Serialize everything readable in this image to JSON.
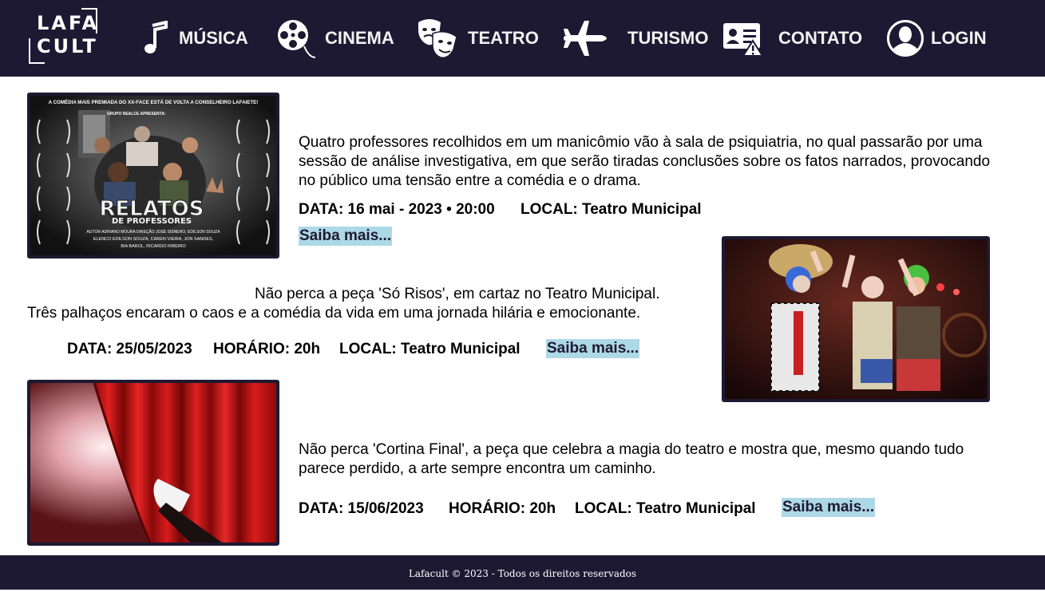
{
  "brand": {
    "line1": "LAFA",
    "line2": "CULT"
  },
  "nav": {
    "musica": "MÚSICA",
    "cinema": "CINEMA",
    "teatro": "TEATRO",
    "turismo": "TURISMO",
    "contato": "CONTATO",
    "login": "LOGIN"
  },
  "events": [
    {
      "poster_text": {
        "top": "A COMÉDIA MAIS PREMIADA DO XX-FACE ESTÁ DE VOLTA A CONSELHEIRO LAFAIETE!",
        "sub": "GRUPO REALCE APRESENTA:",
        "title": "RELATOS",
        "title2": "DE PROFESSORES",
        "credits1": "AUTOR  ADRIANO MOURA   DIREÇÃO  JOSÉ SISNERO, EDILSON SOUZA",
        "credits2": "ELENCO  EDILSON SOUZA, CAREN VIEIRA, JON SANDES,",
        "credits3": "BIA BAROL, RICARDO RIBEIRO"
      },
      "description": "Quatro professores recolhidos em um manicômio vão à sala de psiquiatria, no qual passarão por uma sessão de análise investigativa, em que serão tiradas conclusões sobre os fatos narrados, provocando no público uma tensão entre a comédia e o drama.",
      "date": "DATA: 16 mai - 2023 • 20:00",
      "local": "LOCAL: Teatro Municipal",
      "more": "Saiba mais..."
    },
    {
      "description_line1": "Não perca a peça 'Só Risos', em cartaz no Teatro Municipal.",
      "description_line2": "Três palhaços encaram o caos e a comédia da vida em uma jornada hilária e emocionante.",
      "date": "DATA: 25/05/2023",
      "time": "HORÁRIO: 20h",
      "local": "LOCAL: Teatro Municipal",
      "more": "Saiba mais..."
    },
    {
      "description": "Não perca 'Cortina Final', a peça que celebra a magia do teatro e mostra que, mesmo quando tudo parece perdido, a arte sempre encontra um caminho.",
      "date": "DATA: 15/06/2023",
      "time": "HORÁRIO: 20h",
      "local": "LOCAL: Teatro Municipal",
      "more": "Saiba mais..."
    }
  ],
  "footer": "Lafacult © 2023 - Todos os direitos reservados",
  "colors": {
    "navbar": "#1e1932",
    "link_bg": "#add8e6",
    "text": "#000000"
  }
}
